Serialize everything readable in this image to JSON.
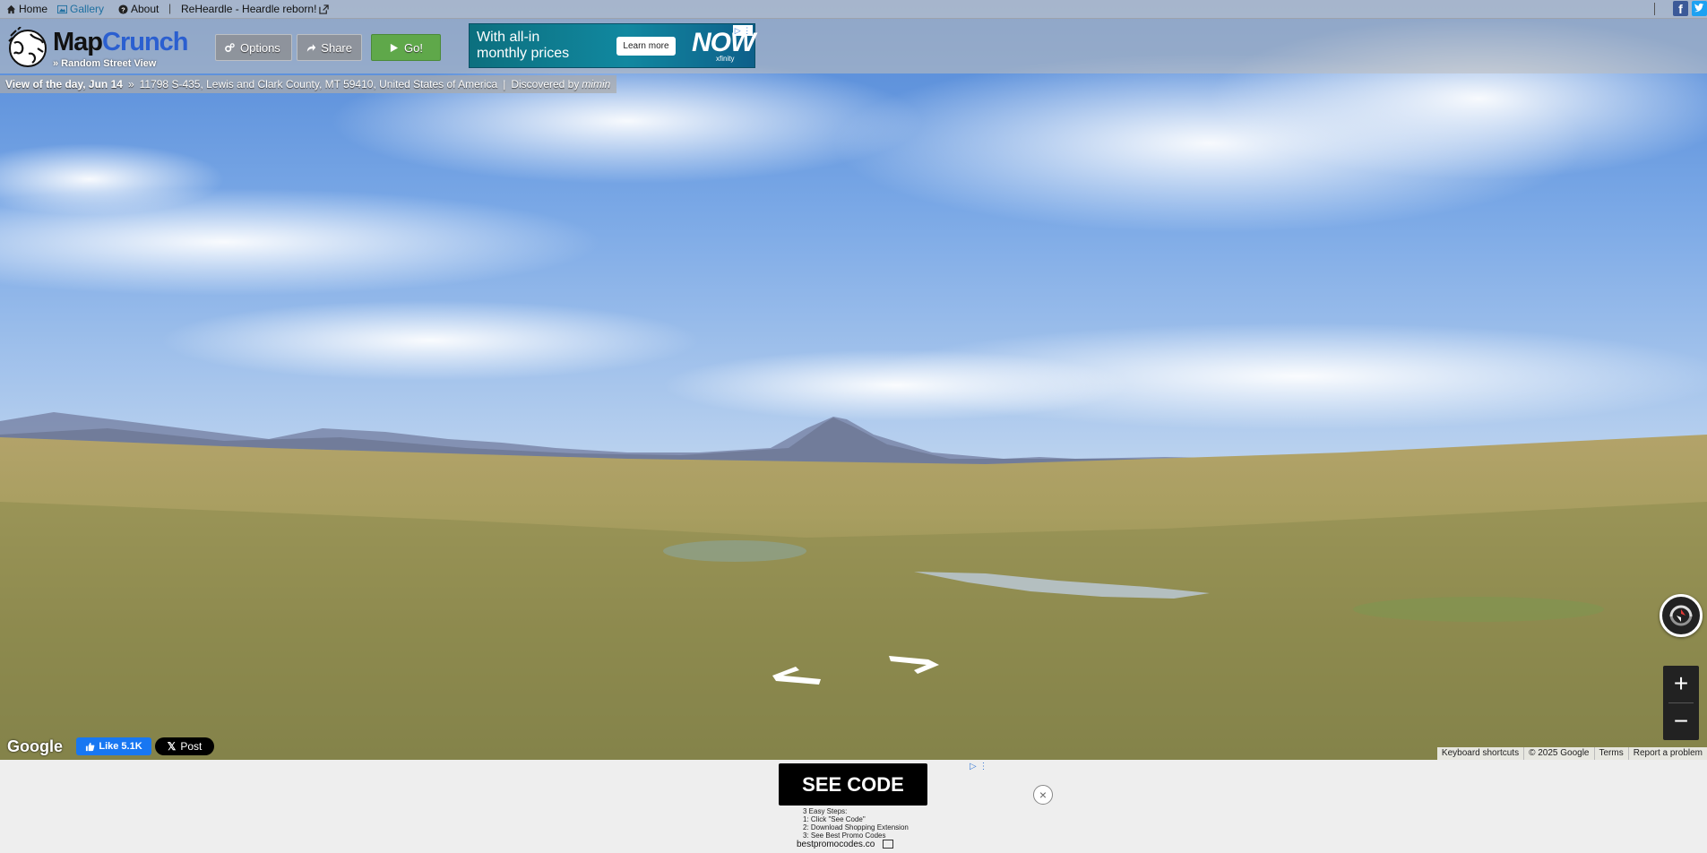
{
  "topnav": {
    "home": "Home",
    "gallery": "Gallery",
    "about": "About",
    "separator": "|",
    "reheardle": "ReHeardle - Heardle reborn!"
  },
  "social": {
    "facebook": "f",
    "twitter": "t"
  },
  "logo": {
    "part1": "Map",
    "part2": "Crunch",
    "tagline": "» Random Street View"
  },
  "header_buttons": {
    "options": "Options",
    "share": "Share",
    "go": "Go!"
  },
  "ad_top": {
    "line1": "With all-in",
    "line2": "monthly prices",
    "cta": "Learn more",
    "brand": "NOW",
    "brand_sub": "xfinity"
  },
  "location": {
    "view_of_day": "View of the day, Jun 14",
    "chevron": "»",
    "address": "11798 S-435, Lewis and Clark County, MT 59410, United States of America",
    "divider": "|",
    "discovered_by": "Discovered by",
    "discoverer": "mimin"
  },
  "pano_controls": {
    "zoom_in": "+",
    "zoom_out": "−"
  },
  "bottom_bar": {
    "google": "Google",
    "fb_like": "Like 5.1K",
    "x_post": "Post",
    "keyboard": "Keyboard shortcuts",
    "copyright": "© 2025 Google",
    "terms": "Terms",
    "report": "Report a problem"
  },
  "ad_bottom": {
    "button": "SEE CODE",
    "steps": [
      "3 Easy Steps:",
      "1: Click \"See Code\"",
      "2: Download Shopping Extension",
      "3: See Best Promo Codes"
    ],
    "domain": "bestpromocodes.co",
    "close": "×"
  },
  "colors": {
    "go_green": "#5fa84a",
    "logo_blue": "#2b5fd0",
    "fb_blue": "#1877f2"
  }
}
